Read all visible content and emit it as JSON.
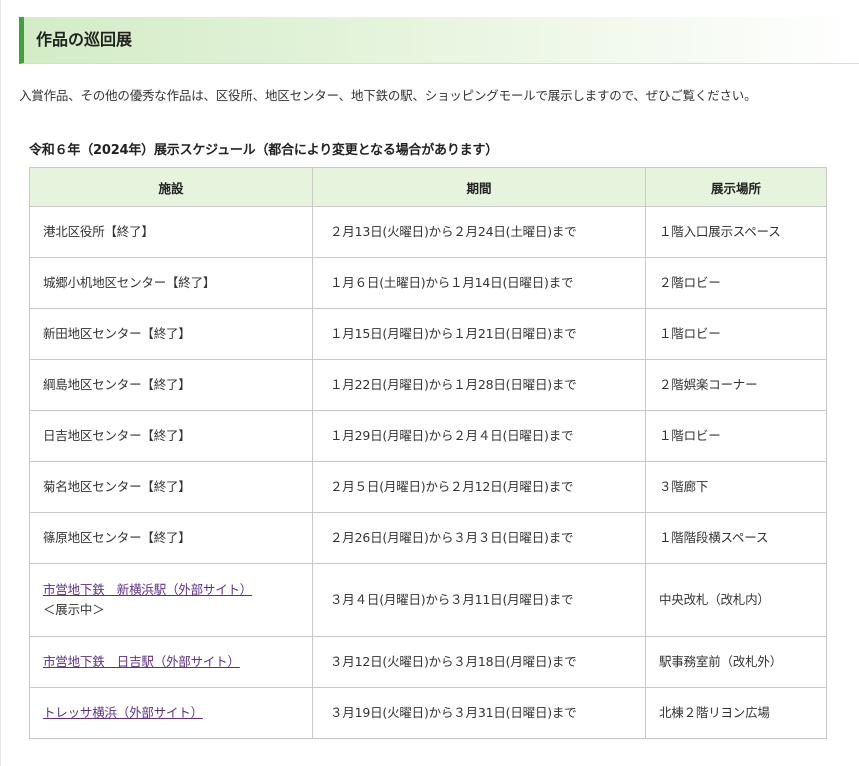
{
  "section": {
    "title": "作品の巡回展"
  },
  "intro": "入賞作品、その他の優秀な作品は、区役所、地区センター、地下鉄の駅、ショッピングモールで展示しますので、ぜひご覧ください。",
  "schedule": {
    "caption": "令和６年（2024年）展示スケジュール（都合により変更となる場合があります）",
    "headers": [
      "施設",
      "期間",
      "展示場所"
    ],
    "rows": [
      {
        "facility": "港北区役所【終了】",
        "period": "２月13日(火曜日)から２月24日(土曜日)まで",
        "place": "１階入口展示スペース"
      },
      {
        "facility": "城郷小机地区センター【終了】",
        "period": "１月６日(土曜日)から１月14日(日曜日)まで",
        "place": "２階ロビー"
      },
      {
        "facility": "新田地区センター【終了】",
        "period": "１月15日(月曜日)から１月21日(日曜日)まで",
        "place": "１階ロビー"
      },
      {
        "facility": "綱島地区センター【終了】",
        "period": "１月22日(月曜日)から１月28日(日曜日)まで",
        "place": "２階娯楽コーナー"
      },
      {
        "facility": "日吉地区センター【終了】",
        "period": "１月29日(月曜日)から２月４日(日曜日)まで",
        "place": "１階ロビー"
      },
      {
        "facility": "菊名地区センター【終了】",
        "period": "２月５日(月曜日)から２月12日(月曜日)まで",
        "place": "３階廊下"
      },
      {
        "facility": "篠原地区センター【終了】",
        "period": "２月26日(月曜日)から３月３日(日曜日)まで",
        "place": "１階階段横スペース"
      },
      {
        "facility_link": "市営地下鉄　新横浜駅（外部サイト）",
        "facility_note": "＜展示中＞",
        "period": "３月４日(月曜日)から３月11日(月曜日)まで",
        "place": "中央改札（改札内）"
      },
      {
        "facility_link": "市営地下鉄　日吉駅（外部サイト）",
        "period": "３月12日(火曜日)から３月18日(月曜日)まで",
        "place": "駅事務室前（改札外）"
      },
      {
        "facility_link": "トレッサ横浜（外部サイト）",
        "period": "３月19日(火曜日)から３月31日(日曜日)まで",
        "place": "北棟２階リヨン広場"
      }
    ]
  },
  "colors": {
    "accent_green": "#3fa13f",
    "header_fill": "#e6f4dd",
    "link_purple": "#5f2f87"
  }
}
